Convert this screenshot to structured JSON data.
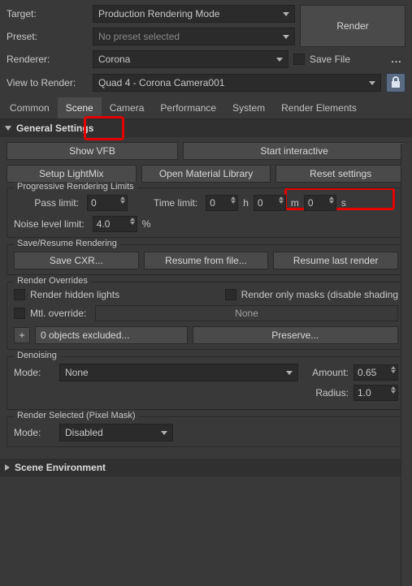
{
  "top": {
    "target_label": "Target:",
    "target_value": "Production Rendering Mode",
    "preset_label": "Preset:",
    "preset_value": "No preset selected",
    "renderer_label": "Renderer:",
    "renderer_value": "Corona",
    "render_btn": "Render",
    "savefile_label": "Save File",
    "dots": "..."
  },
  "view": {
    "label": "View to Render:",
    "value": "Quad 4 - Corona Camera001"
  },
  "tabs": {
    "common": "Common",
    "scene": "Scene",
    "camera": "Camera",
    "performance": "Performance",
    "system": "System",
    "render_elements": "Render Elements"
  },
  "general": {
    "title": "General Settings",
    "show_vfb": "Show VFB",
    "start_interactive": "Start interactive",
    "setup_lightmix": "Setup LightMix",
    "open_matlib": "Open Material Library",
    "reset_settings": "Reset settings",
    "progressive": {
      "title": "Progressive Rendering Limits",
      "pass_label": "Pass limit:",
      "pass_val": "0",
      "time_label": "Time limit:",
      "time_h": "0",
      "time_m": "0",
      "time_s": "0",
      "h": "h",
      "m": "m",
      "s": "s",
      "noise_label": "Noise level limit:",
      "noise_val": "4.0",
      "pct": "%"
    },
    "save_resume": {
      "title": "Save/Resume Rendering",
      "save_cxr": "Save CXR...",
      "resume_file": "Resume from file...",
      "resume_last": "Resume last render"
    },
    "overrides": {
      "title": "Render Overrides",
      "hidden_lights": "Render hidden lights",
      "only_masks": "Render only masks (disable shading",
      "mtl_override": "Mtl. override:",
      "none": "None",
      "plus": "+",
      "excluded": "0 objects excluded...",
      "preserve": "Preserve..."
    },
    "denoise": {
      "title": "Denoising",
      "mode_label": "Mode:",
      "mode_value": "None",
      "amount_label": "Amount:",
      "amount_val": "0.65",
      "radius_label": "Radius:",
      "radius_val": "1.0"
    },
    "render_sel": {
      "title": "Render Selected (Pixel Mask)",
      "mode_label": "Mode:",
      "mode_value": "Disabled"
    }
  },
  "scene_env": {
    "title": "Scene Environment"
  }
}
